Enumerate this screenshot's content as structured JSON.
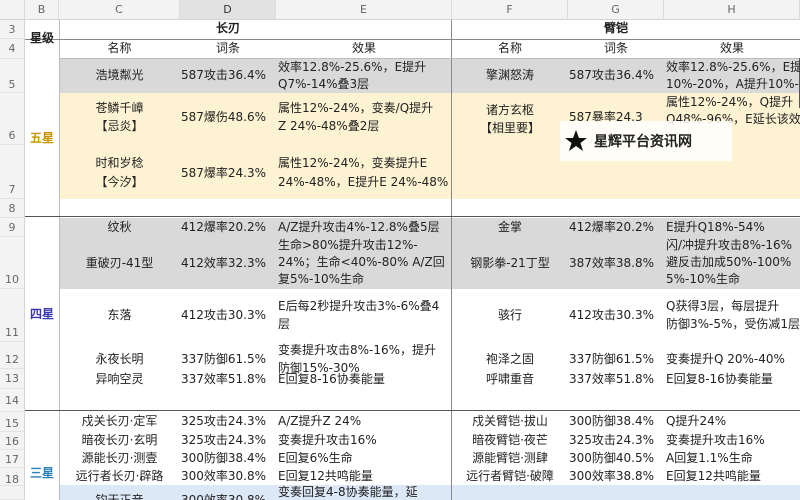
{
  "columns": [
    "B",
    "C",
    "D",
    "E",
    "F",
    "G",
    "H"
  ],
  "rows": [
    "3",
    "4",
    "5",
    "6",
    "7",
    "8",
    "9",
    "10",
    "11",
    "12",
    "13",
    "14",
    "15",
    "16",
    "17",
    "18"
  ],
  "headers": {
    "star_level": "星级",
    "blade_group": "长刃",
    "armguard_group": "臂铠",
    "name": "名称",
    "stat": "词条",
    "effect": "效果"
  },
  "stars": {
    "five": "五星",
    "four": "四星",
    "three": "三星"
  },
  "watermark": {
    "text": "星辉平台资讯网",
    "icon": "star-logo-icon"
  },
  "colors": {
    "gray": "#d9d9d9",
    "cream": "#fdf2d2",
    "blue": "#dde8f7",
    "five_star": "#c89200",
    "four_star": "#3a3ab0",
    "three_star": "#2a80b8"
  },
  "five_star": {
    "r1": {
      "blade_name": "浩境粼光",
      "blade_stat": "587攻击36.4%",
      "blade_eff1": "效率12.8%-25.6%，E提升",
      "blade_eff2": "Q7%-14%叠3层",
      "arm_name": "擎渊怒涛",
      "arm_stat": "587攻击36.4%",
      "arm_eff1": "效率12.8%-25.6%，E提",
      "arm_eff2": "10%-20%，A提升10%-"
    },
    "r2": {
      "blade_name1": "苍鳞千嶂",
      "blade_name2": "【忌炎】",
      "blade_stat": "587爆伤48.6%",
      "blade_eff1": "属性12%-24%，变奏/Q提升",
      "blade_eff2": "Z 24%-48%叠2层",
      "arm_name1": "诸方玄枢",
      "arm_name2": "【相里要】",
      "arm_stat": "587暴率24.3",
      "arm_eff1": "属性12%-24%，Q提升",
      "arm_eff2": "Q48%-96%，E延长该效"
    },
    "r3": {
      "blade_name1": "时和岁稔",
      "blade_name2": "【今汐】",
      "blade_stat": "587爆率24.3%",
      "blade_eff1": "属性12%-24%，变奏提升E",
      "blade_eff2": "24%-48%，E提升E 24%-48%"
    }
  },
  "four_star": {
    "r1": {
      "blade_name": "纹秋",
      "blade_stat": "412爆率20.2%",
      "blade_eff": "A/Z提升攻击4%-12.8%叠5层",
      "arm_name": "金掌",
      "arm_stat": "412爆率20.2%",
      "arm_eff": "E提升Q18%-54%"
    },
    "r2": {
      "blade_name": "重破刃-41型",
      "blade_stat": "412效率32.3%",
      "blade_eff1": "生命>80%提升攻击12%-",
      "blade_eff2": "24%；生命<40%-80% A/Z回",
      "blade_eff3": "复5%-10%生命",
      "arm_name": "钢影拳-21丁型",
      "arm_stat": "387效率38.8%",
      "arm_eff1": "闪/冲提升攻击8%-16%",
      "arm_eff2": "避反击加成50%-100%",
      "arm_eff3": "5%-10%生命"
    },
    "r3": {
      "blade_name": "东落",
      "blade_stat": "412攻击30.3%",
      "blade_eff1": "E后每2秒提升攻击3%-6%叠4",
      "blade_eff2": "层",
      "arm_name": "骇行",
      "arm_stat": "412攻击30.3%",
      "arm_eff1": "Q获得3层，每层提升",
      "arm_eff2": "防御3%-5%，受伤减1层"
    },
    "r4": {
      "blade_name": "永夜长明",
      "blade_stat": "337防御61.5%",
      "blade_eff1": "变奏提升攻击8%-16%，提升",
      "blade_eff2": "防御15%-30%",
      "arm_name": "袍泽之固",
      "arm_stat": "337防御61.5%",
      "arm_eff": "变奏提升Q 20%-40%"
    },
    "r5": {
      "blade_name": "异响空灵",
      "blade_stat": "337效率51.8%",
      "blade_eff": "E回复8-16协奏能量",
      "arm_name": "呼啸重音",
      "arm_stat": "337效率51.8%",
      "arm_eff": "E回复8-16协奏能量"
    }
  },
  "three_star": {
    "r1": {
      "blade_name": "戍关长刃·定军",
      "blade_stat": "325攻击24.3%",
      "blade_eff": "A/Z提升Z 24%",
      "arm_name": "戍关臂铠·拔山",
      "arm_stat": "300防御38.4%",
      "arm_eff": "Q提升24%"
    },
    "r2": {
      "blade_name": "暗夜长刃·玄明",
      "blade_stat": "325攻击24.3%",
      "blade_eff": "变奏提升攻击16%",
      "arm_name": "暗夜臂铠·夜芒",
      "arm_stat": "325攻击24.3%",
      "arm_eff": "变奏提升攻击16%"
    },
    "r3": {
      "blade_name": "源能长刃·测壹",
      "blade_stat": "300防御38.4%",
      "blade_eff": "E回复6%生命",
      "arm_name": "源能臂铠·测肆",
      "arm_stat": "300防御40.5%",
      "arm_eff": "A回复1.1%生命"
    },
    "r4": {
      "blade_name": "远行者长刃·辟路",
      "blade_stat": "300效率30.8%",
      "blade_eff": "E回复12共鸣能量",
      "arm_name": "远行者臂铠·破障",
      "arm_stat": "300效率38.8%",
      "arm_eff": "E回复12共鸣能量"
    },
    "r5": {
      "blade_name": "钧天正音",
      "blade_stat": "300效率30.8%",
      "blade_eff": "变奏回复4-8协奏能量，延"
    }
  }
}
